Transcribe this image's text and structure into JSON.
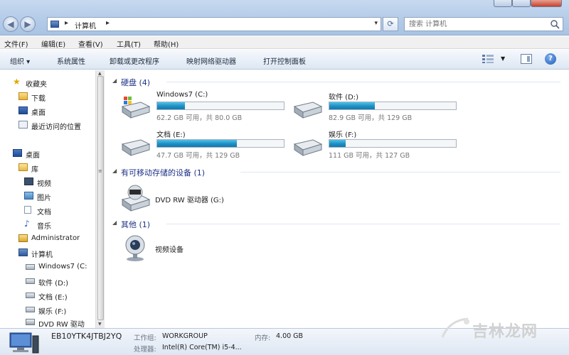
{
  "address_bar": {
    "breadcrumb": "计算机",
    "search_placeholder": "搜索 计算机"
  },
  "menu": {
    "items": [
      "文件(F)",
      "编辑(E)",
      "查看(V)",
      "工具(T)",
      "帮助(H)"
    ]
  },
  "commands": {
    "items": [
      "组织 ▾",
      "系统属性",
      "卸载或更改程序",
      "映射网络驱动器",
      "打开控制面板"
    ]
  },
  "nav": {
    "favorites": "收藏夹",
    "downloads": "下载",
    "desktop_fav": "桌面",
    "recent": "最近访问的位置",
    "desktop": "桌面",
    "libraries": "库",
    "videos": "视频",
    "pictures": "图片",
    "documents": "文档",
    "music": "音乐",
    "administrator": "Administrator",
    "computer": "计算机",
    "drive_c": "Windows7 (C:",
    "drive_d": "软件 (D:)",
    "drive_e": "文档 (E:)",
    "drive_f": "娱乐 (F:)",
    "drive_g": "DVD RW 驱动"
  },
  "groups": {
    "hard_disks": "硬盘 (4)",
    "removable": "有可移动存储的设备 (1)",
    "other": "其他 (1)"
  },
  "drives": [
    {
      "name": "Windows7 (C:)",
      "info": "62.2 GB 可用，共 80.0 GB",
      "used_fraction": 0.22
    },
    {
      "name": "软件 (D:)",
      "info": "82.9 GB 可用，共 129 GB",
      "used_fraction": 0.36
    },
    {
      "name": "文档 (E:)",
      "info": "47.7 GB 可用，共 129 GB",
      "used_fraction": 0.63
    },
    {
      "name": "娱乐 (F:)",
      "info": "111 GB 可用，共 127 GB",
      "used_fraction": 0.13
    }
  ],
  "removable_items": [
    {
      "name": "DVD RW 驱动器 (G:)"
    }
  ],
  "other_items": [
    {
      "name": "视频设备"
    }
  ],
  "details": {
    "computer_name": "EB10YTK4JTBJ2YQ",
    "workgroup_label": "工作组:",
    "workgroup": "WORKGROUP",
    "memory_label": "内存:",
    "memory": "4.00 GB",
    "processor_label": "处理器:",
    "processor": "Intel(R) Core(TM) i5-4..."
  },
  "watermark": {
    "text": "吉林龙网"
  },
  "colors": {
    "usage_fill": "#1e8fc4",
    "group_header": "#1e3287"
  }
}
